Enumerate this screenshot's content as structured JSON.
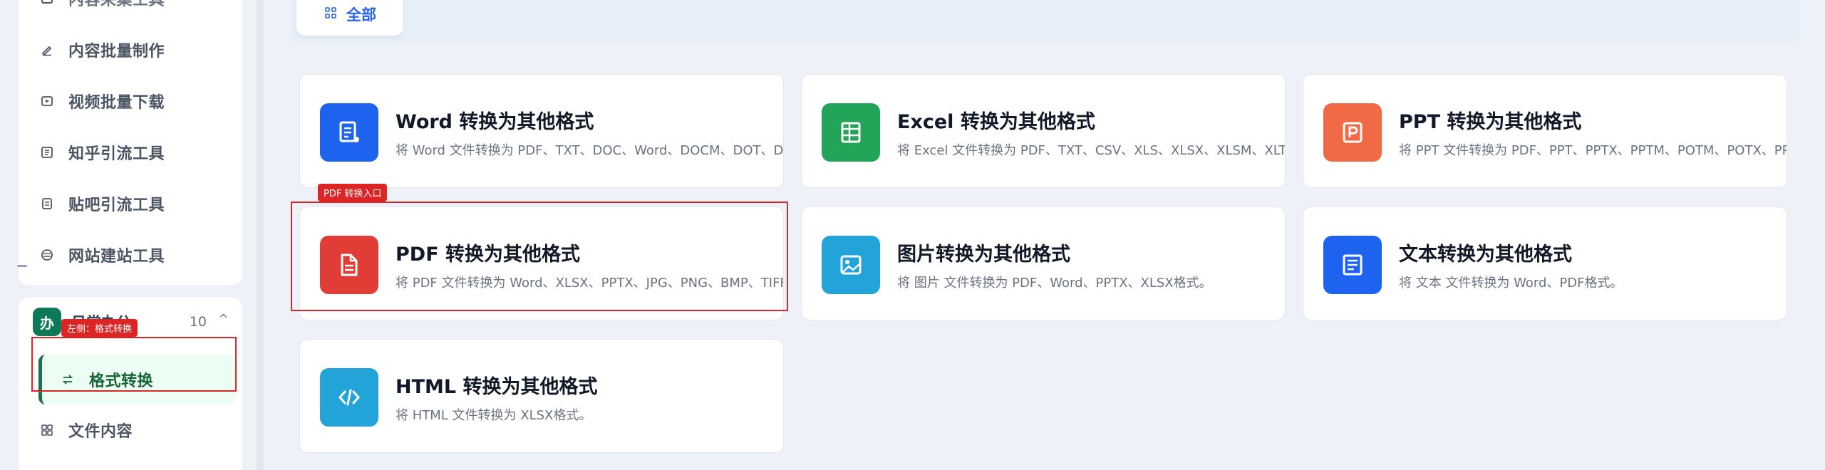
{
  "sidebar": {
    "items_top": [
      {
        "label": "内容采集工具",
        "icon": "collect-icon"
      },
      {
        "label": "内容批量制作",
        "icon": "pen-icon"
      },
      {
        "label": "视频批量下载",
        "icon": "video-download-icon"
      },
      {
        "label": "知乎引流工具",
        "icon": "zhihu-icon"
      },
      {
        "label": "贴吧引流工具",
        "icon": "tieba-icon"
      },
      {
        "label": "网站建站工具",
        "icon": "website-icon"
      }
    ],
    "group": {
      "badge": "办",
      "title": "日常办公",
      "count": "10",
      "chevron": "^"
    },
    "items_bottom": [
      {
        "label": "格式转换",
        "icon": "convert-icon"
      },
      {
        "label": "文件内容",
        "icon": "grid-icon"
      }
    ]
  },
  "annotations": {
    "sidebar_tag": "左侧：格式转换",
    "pdf_tag": "PDF 转换入口"
  },
  "filter": {
    "label": "全部",
    "icon": "grid-icon"
  },
  "tools": [
    {
      "title": "Word 转换为其他格式",
      "desc": "将 Word 文件转换为 PDF、TXT、DOC、Word、DOCM、DOT、DOTX、RTF、ODT、HTML、XML等格式。",
      "color": "#1d63f0",
      "icon": "word-doc-icon"
    },
    {
      "title": "Excel 转换为其他格式",
      "desc": "将 Excel 文件转换为 PDF、TXT、CSV、XLS、XLSX、XLSM、XLTX、XLTM、ODS等格式。",
      "color": "#22a559",
      "icon": "excel-sheet-icon"
    },
    {
      "title": "PPT 转换为其他格式",
      "desc": "将 PPT 文件转换为 PDF、PPT、PPTX、PPTM、POTM、POTX、PPS、PPSX等格式。",
      "color": "#f06a45",
      "icon": "ppt-icon"
    },
    {
      "title": "PDF 转换为其他格式",
      "desc": "将 PDF 文件转换为 Word、XLSX、PPTX、JPG、PNG、BMP、TIFF格式。",
      "color": "#e13c35",
      "icon": "pdf-file-icon"
    },
    {
      "title": "图片转换为其他格式",
      "desc": "将 图片 文件转换为 PDF、Word、PPTX、XLSX格式。",
      "color": "#22a4d8",
      "icon": "image-icon"
    },
    {
      "title": "文本转换为其他格式",
      "desc": "将 文本 文件转换为 Word、PDF格式。",
      "color": "#1d63f0",
      "icon": "text-doc-icon"
    },
    {
      "title": "HTML 转换为其他格式",
      "desc": "将 HTML 文件转换为 XLSX格式。",
      "color": "#22a4d8",
      "icon": "html-code-icon"
    }
  ]
}
